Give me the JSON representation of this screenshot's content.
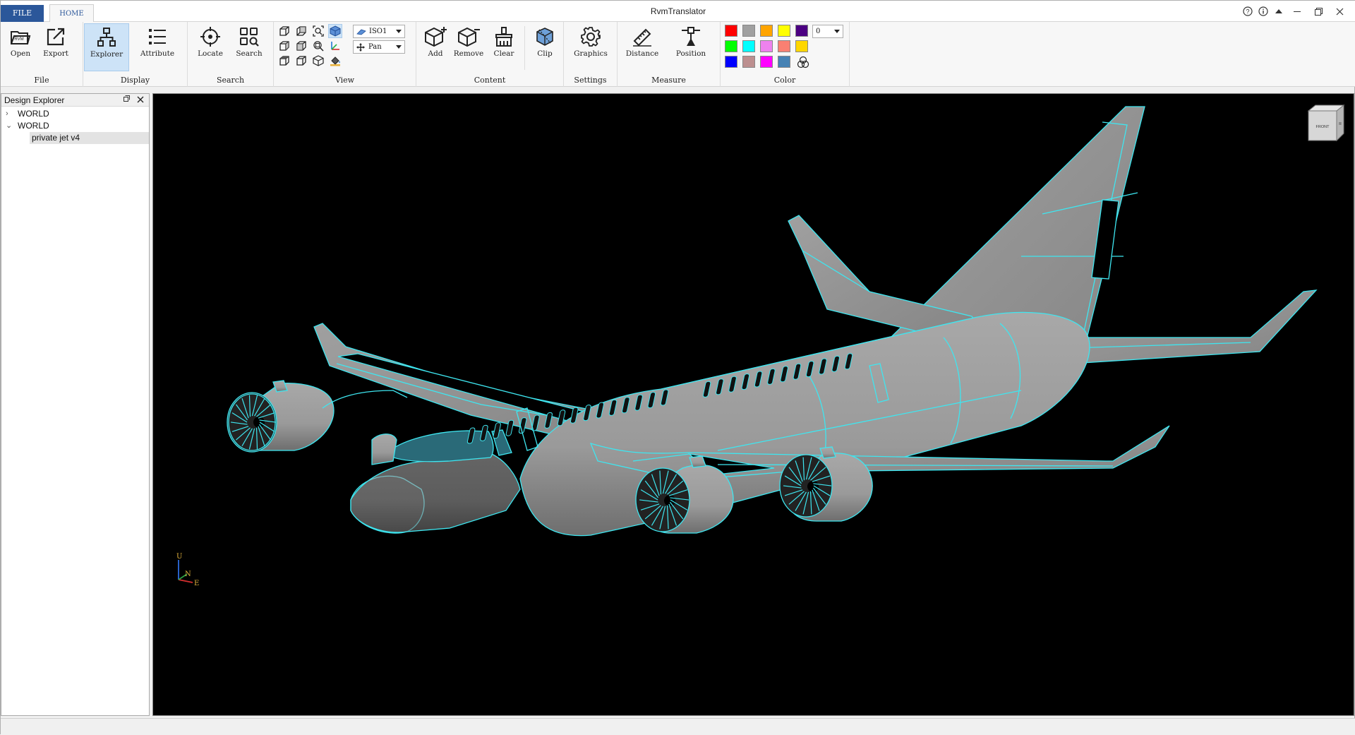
{
  "app": {
    "title": "RvmTranslator"
  },
  "tabs": {
    "file": "FILE",
    "home": "HOME"
  },
  "ribbon": {
    "file": {
      "label": "File",
      "open": "Open",
      "export": "Export",
      "rvm_text": "RVM"
    },
    "display": {
      "label": "Display",
      "explorer": "Explorer",
      "attribute": "Attribute"
    },
    "search": {
      "label": "Search",
      "locate": "Locate",
      "search": "Search"
    },
    "view": {
      "label": "View",
      "projection": "ISO1",
      "mode": "Pan"
    },
    "content": {
      "label": "Content",
      "add": "Add",
      "remove": "Remove",
      "clear": "Clear",
      "clip": "Clip"
    },
    "settings": {
      "label": "Settings",
      "graphics": "Graphics"
    },
    "measure": {
      "label": "Measure",
      "distance": "Distance",
      "position": "Position"
    },
    "color": {
      "label": "Color",
      "transparency": "0",
      "swatches": [
        "#ff0000",
        "#a0a0a0",
        "#ffa500",
        "#ffff00",
        "#4b0082",
        "#00ff00",
        "#00ffff",
        "#ee82ee",
        "#fa8072",
        "#ffd700",
        "#0000ff",
        "#bc8f8f",
        "#ff00ff",
        "#4682b4"
      ]
    }
  },
  "explorer": {
    "title": "Design Explorer",
    "items": [
      {
        "label": "WORLD",
        "expander": "›"
      },
      {
        "label": "WORLD",
        "expander": "⌄"
      },
      {
        "label": "private jet v4"
      }
    ]
  },
  "viewport": {
    "background": "#000000",
    "wire_color": "#3ee6f0",
    "body_color": "#9a9a9a",
    "nav_cube": {
      "front": "FRONT",
      "right": "R"
    },
    "axis": {
      "up": "U",
      "north": "N",
      "east": "E"
    }
  }
}
